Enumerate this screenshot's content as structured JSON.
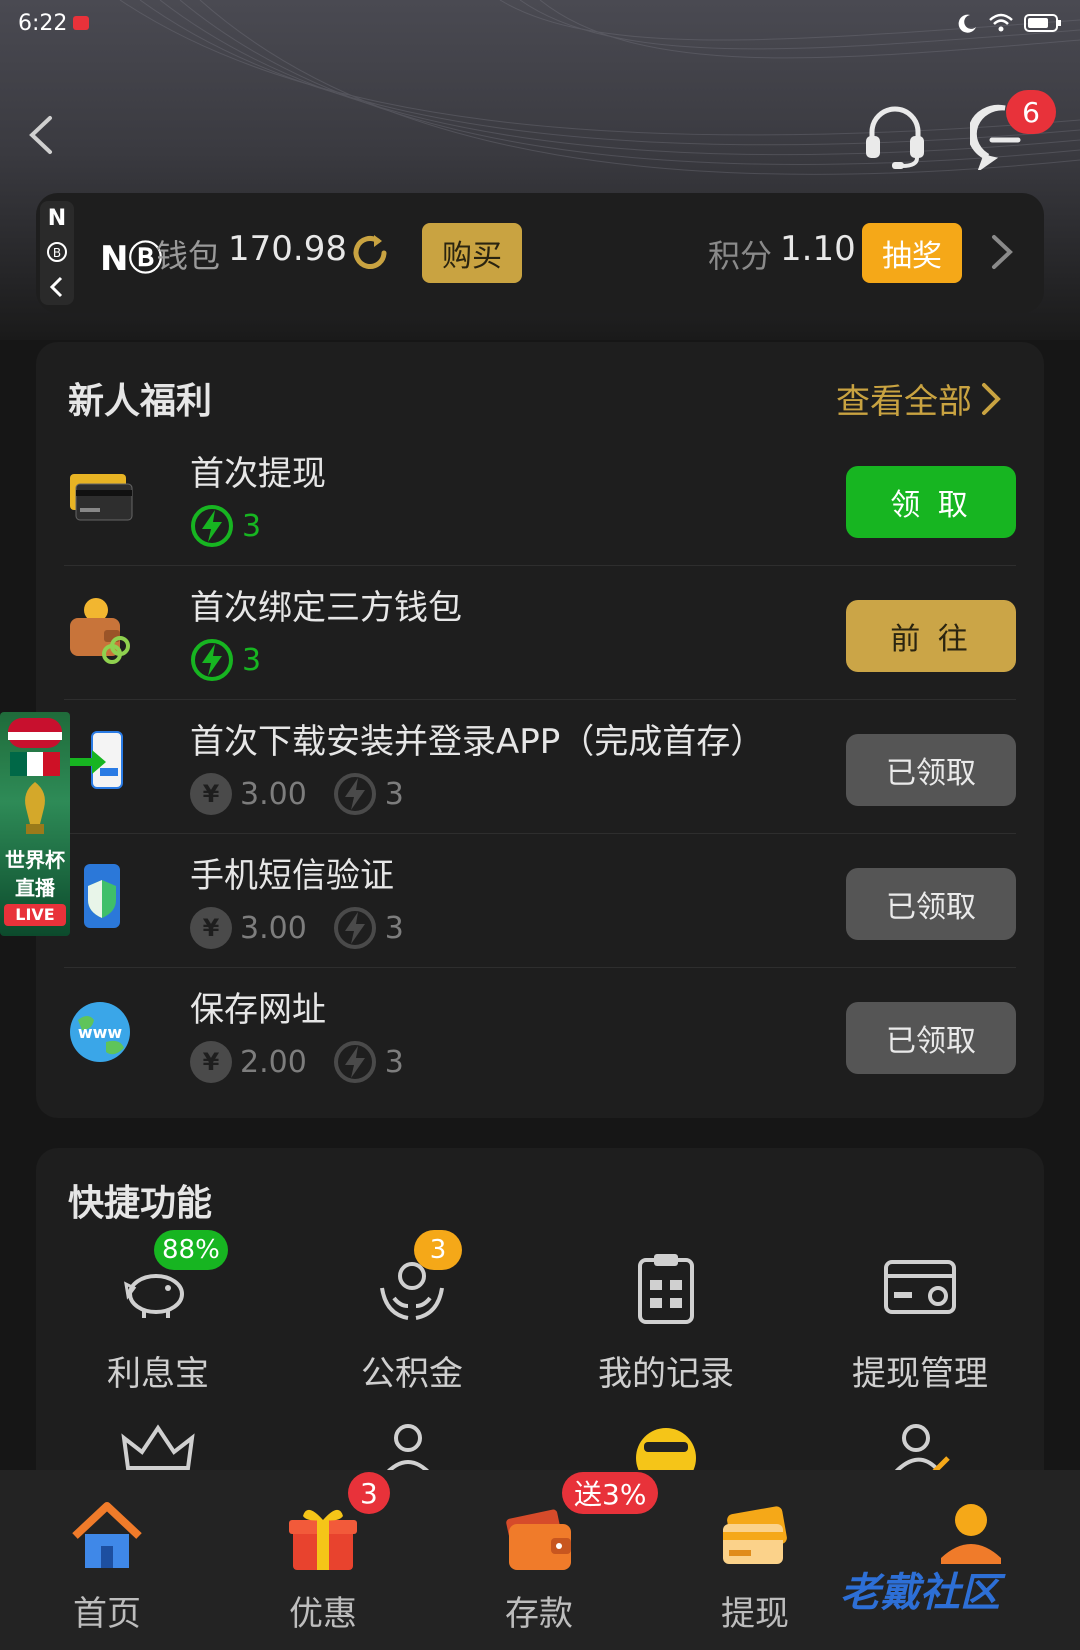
{
  "status_bar": {
    "time": "6:22"
  },
  "header": {
    "message_badge": "6"
  },
  "wallet": {
    "brand": "NⒷ",
    "label": "钱包",
    "value": "170.98",
    "buy_label": "购买",
    "points_label": "积分",
    "points_value": "1.10",
    "draw_label": "抽奖"
  },
  "welfare": {
    "title": "新人福利",
    "view_all": "查看全部",
    "tasks": [
      {
        "title": "首次提现",
        "money": "",
        "bolt": "3",
        "button": "领 取",
        "state": "claim"
      },
      {
        "title": "首次绑定三方钱包",
        "money": "",
        "bolt": "3",
        "button": "前 往",
        "state": "goto"
      },
      {
        "title": "首次下载安装并登录APP（完成首存）",
        "money": "3.00",
        "bolt": "3",
        "button": "已领取",
        "state": "done"
      },
      {
        "title": "手机短信验证",
        "money": "3.00",
        "bolt": "3",
        "button": "已领取",
        "state": "done"
      },
      {
        "title": "保存网址",
        "money": "2.00",
        "bolt": "3",
        "button": "已领取",
        "state": "done"
      }
    ]
  },
  "live_banner": {
    "line1": "世界杯",
    "line2": "直播",
    "badge": "LIVE"
  },
  "quick": {
    "title": "快捷功能",
    "items": [
      {
        "label": "利息宝",
        "badge": "88%"
      },
      {
        "label": "公积金",
        "badge": "3"
      },
      {
        "label": "我的记录",
        "badge": ""
      },
      {
        "label": "提现管理",
        "badge": ""
      }
    ]
  },
  "nav": {
    "items": [
      {
        "label": "首页",
        "badge": ""
      },
      {
        "label": "优惠",
        "badge": "3"
      },
      {
        "label": "存款",
        "badge": "送3%"
      },
      {
        "label": "提现",
        "badge": ""
      },
      {
        "label": "",
        "badge": ""
      }
    ]
  },
  "watermark": "老戴社区",
  "colors": {
    "gold": "#c9a341",
    "orange": "#f5a818",
    "green": "#17b521",
    "red": "#e8323a",
    "card": "#1e1e1e",
    "background": "#161616"
  }
}
